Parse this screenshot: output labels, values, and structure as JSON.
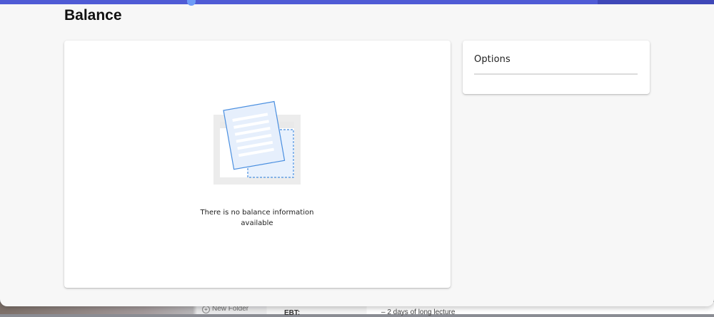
{
  "page": {
    "title": "Balance"
  },
  "balance_card": {
    "empty_message": "There is no balance information available",
    "illustration_icon": "empty-document-icon"
  },
  "options_card": {
    "title": "Options"
  },
  "background_window": {
    "folder_label": "New Folder",
    "ebt_label": "EBT:",
    "lecture_text": "2 days of long lecture"
  },
  "colors": {
    "accent": "#4f5bd5",
    "page_bg": "#f7f7f7",
    "card_bg": "#ffffff",
    "illustration_blue": "#4a8fe0"
  }
}
